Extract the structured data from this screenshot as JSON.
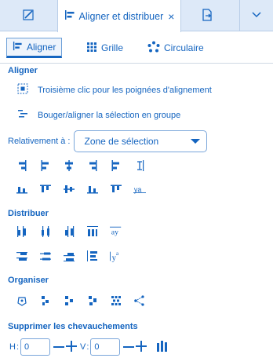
{
  "tabs": {
    "icon1": "edit-icon",
    "active_label": "Aligner et distribuer",
    "close_glyph": "×",
    "icon3": "export-icon",
    "icon4": "chevron-down-icon"
  },
  "subtabs": [
    {
      "label": "Aligner",
      "icon": "align-left-icon"
    },
    {
      "label": "Grille",
      "icon": "grid-icon"
    },
    {
      "label": "Circulaire",
      "icon": "circular-icon"
    }
  ],
  "sections": {
    "aligner": "Aligner",
    "distribuer": "Distribuer",
    "organiser": "Organiser",
    "chevauchements": "Supprimer les chevauchements"
  },
  "options": {
    "third_click": "Troisième clic pour les poignées d'alignement",
    "move_group": "Bouger/aligner la sélection en groupe"
  },
  "relative": {
    "label": "Relativement à :",
    "value": "Zone de sélection"
  },
  "overlap": {
    "h_label": "H",
    "h_value": "0",
    "v_label": "V",
    "v_value": "0",
    "minus": "—",
    "plus": "+"
  },
  "colors": {
    "accent": "#1565c0",
    "tabbar_bg": "#dde9f8"
  }
}
